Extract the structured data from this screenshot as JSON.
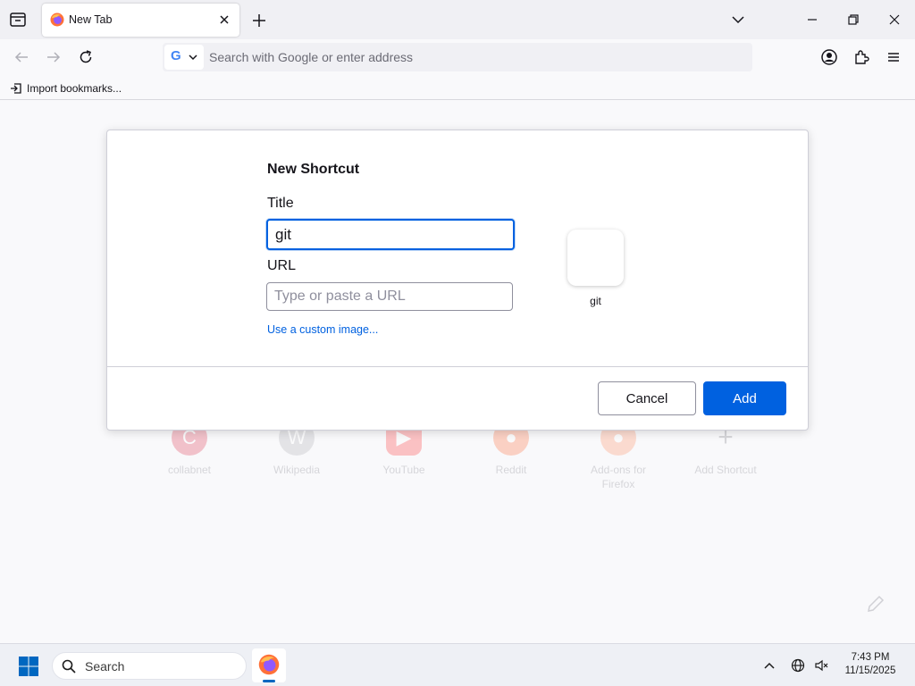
{
  "browser": {
    "tab": {
      "label": "New Tab"
    },
    "urlbar": {
      "placeholder": "Search with Google or enter address"
    },
    "bookmarks_bar": {
      "import_label": "Import bookmarks..."
    }
  },
  "top_sites": [
    {
      "label": "collabnet",
      "color": "#d70022",
      "glyph": "C"
    },
    {
      "label": "Wikipedia",
      "color": "#9a9aa0",
      "glyph": "W"
    },
    {
      "label": "YouTube",
      "color": "#ff0000",
      "glyph": "▶"
    },
    {
      "label": "Reddit",
      "color": "#ff4500",
      "glyph": "●"
    },
    {
      "label": "Add-ons for Firefox",
      "color": "#ff7139",
      "glyph": "●"
    },
    {
      "label": "Add Shortcut",
      "color": "#ffffff",
      "glyph": "+"
    }
  ],
  "dialog": {
    "title": "New Shortcut",
    "title_field_label": "Title",
    "title_value": "git",
    "url_field_label": "URL",
    "url_placeholder": "Type or paste a URL",
    "custom_image_link": "Use a custom image...",
    "preview_label": "git",
    "cancel_label": "Cancel",
    "add_label": "Add"
  },
  "taskbar": {
    "search_label": "Search",
    "time": "7:43 PM",
    "date": "11/15/2025"
  },
  "colors": {
    "accent": "#0061e0",
    "windows_blue": "#0067c0"
  }
}
